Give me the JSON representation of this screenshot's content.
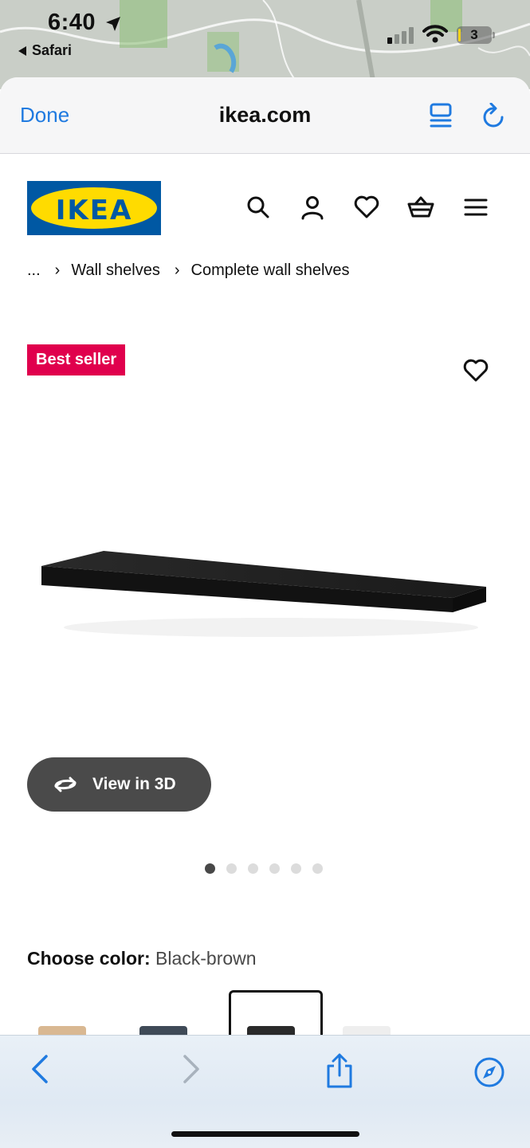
{
  "status_bar": {
    "time": "6:40",
    "back_app": "Safari",
    "battery": "3"
  },
  "safari": {
    "done_label": "Done",
    "url": "ikea.com"
  },
  "site": {
    "logo_text": "IKEA",
    "brand_colors": {
      "blue": "#0058a3",
      "yellow": "#ffdb00"
    },
    "nav_icons": [
      "search-icon",
      "account-icon",
      "favourites-icon",
      "cart-icon",
      "menu-icon"
    ]
  },
  "breadcrumb": {
    "ellipsis": "...",
    "items": [
      "Wall shelves",
      "Complete wall shelves"
    ]
  },
  "product": {
    "badge": "Best seller",
    "badge_color": "#e0004d",
    "view_3d_label": "View in 3D",
    "gallery_count": 6,
    "gallery_active_index": 0
  },
  "color_choice": {
    "label": "Choose color:",
    "value": "Black-brown"
  },
  "toolbar": {
    "icons": [
      "back-icon",
      "forward-icon",
      "share-icon",
      "compass-icon"
    ],
    "accent": "#1f7ae0"
  }
}
